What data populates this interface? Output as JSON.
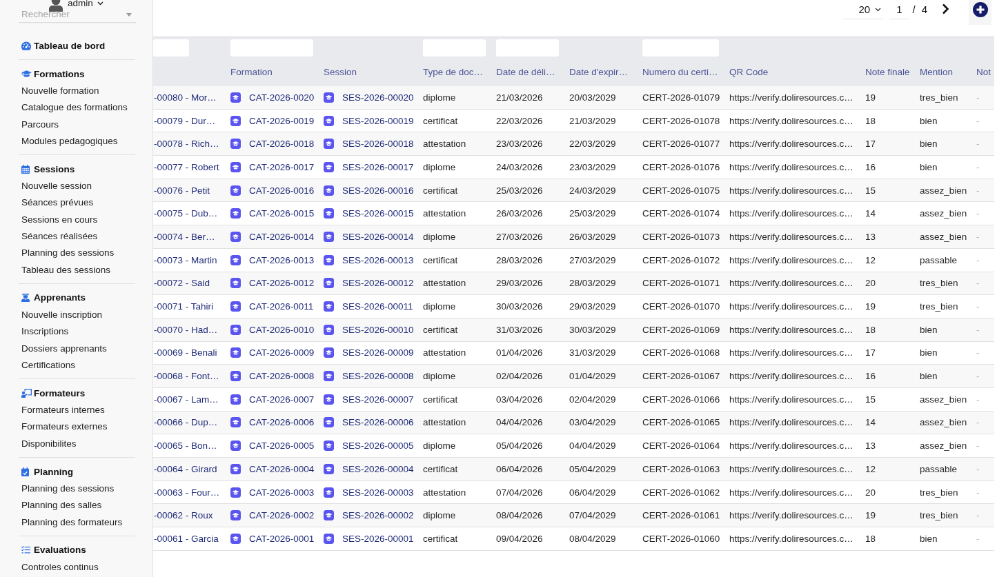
{
  "user_menu": {
    "name": "admin"
  },
  "sidebar": {
    "search": {
      "placeholder": "Rechercher"
    },
    "sections": [
      {
        "title": "Tableau de bord"
      },
      {
        "title": "Formations",
        "items": [
          "Nouvelle formation",
          "Catalogue des formations",
          "Parcours",
          "Modules pedagogiques"
        ]
      },
      {
        "title": "Sessions",
        "items": [
          "Nouvelle session",
          "Séances prévues",
          "Sessions en cours",
          "Séances réalisées",
          "Planning des sessions",
          "Tableau des sessions"
        ]
      },
      {
        "title": "Apprenants",
        "items": [
          "Nouvelle inscription",
          "Inscriptions",
          "Dossiers apprenants",
          "Certifications"
        ]
      },
      {
        "title": "Formateurs",
        "items": [
          "Formateurs internes",
          "Formateurs externes",
          "Disponibilites"
        ]
      },
      {
        "title": "Planning",
        "items": [
          "Planning des sessions",
          "Planning des salles",
          "Planning des formateurs"
        ]
      },
      {
        "title": "Evaluations",
        "items": [
          "Controles continus"
        ]
      }
    ]
  },
  "pagination": {
    "page_size": "20",
    "page": "1",
    "separator": "/",
    "total_pages": "4"
  },
  "table": {
    "columns": [
      {
        "kind": "link",
        "filter": true
      },
      {
        "label": "Formation",
        "kind": "link_icon",
        "filter": true
      },
      {
        "label": "Session",
        "kind": "link_icon",
        "filter": false
      },
      {
        "label": "Type de doc…",
        "kind": "text",
        "filter": true
      },
      {
        "label": "Date de déli…",
        "kind": "text",
        "filter": true
      },
      {
        "label": "Date d'expir…",
        "kind": "text",
        "filter": false
      },
      {
        "label": "Numero du certi…",
        "kind": "text",
        "filter": true
      },
      {
        "label": "QR Code",
        "kind": "text",
        "filter": false
      },
      {
        "label": "Note finale",
        "kind": "text",
        "filter": false
      },
      {
        "label": "Mention",
        "kind": "text",
        "filter": false
      },
      {
        "label": "Not",
        "kind": "muted",
        "filter": false
      }
    ],
    "rows": [
      [
        "-00080 - Mor…",
        "CAT-2026-0020",
        "SES-2026-00020",
        "diplome",
        "21/03/2026",
        "20/03/2029",
        "CERT-2026-01079",
        "https://verify.doliresources.c…",
        "19",
        "tres_bien",
        "-"
      ],
      [
        "-00079 - Dur…",
        "CAT-2026-0019",
        "SES-2026-00019",
        "certificat",
        "22/03/2026",
        "21/03/2029",
        "CERT-2026-01078",
        "https://verify.doliresources.c…",
        "18",
        "bien",
        "-"
      ],
      [
        "-00078 - Rich…",
        "CAT-2026-0018",
        "SES-2026-00018",
        "attestation",
        "23/03/2026",
        "22/03/2029",
        "CERT-2026-01077",
        "https://verify.doliresources.c…",
        "17",
        "bien",
        "-"
      ],
      [
        "-00077 - Robert",
        "CAT-2026-0017",
        "SES-2026-00017",
        "diplome",
        "24/03/2026",
        "23/03/2029",
        "CERT-2026-01076",
        "https://verify.doliresources.c…",
        "16",
        "bien",
        "-"
      ],
      [
        "-00076 - Petit",
        "CAT-2026-0016",
        "SES-2026-00016",
        "certificat",
        "25/03/2026",
        "24/03/2029",
        "CERT-2026-01075",
        "https://verify.doliresources.c…",
        "15",
        "assez_bien",
        "-"
      ],
      [
        "-00075 - Dub…",
        "CAT-2026-0015",
        "SES-2026-00015",
        "attestation",
        "26/03/2026",
        "25/03/2029",
        "CERT-2026-01074",
        "https://verify.doliresources.c…",
        "14",
        "assez_bien",
        "-"
      ],
      [
        "-00074 - Ber…",
        "CAT-2026-0014",
        "SES-2026-00014",
        "diplome",
        "27/03/2026",
        "26/03/2029",
        "CERT-2026-01073",
        "https://verify.doliresources.c…",
        "13",
        "assez_bien",
        "-"
      ],
      [
        "-00073 - Martin",
        "CAT-2026-0013",
        "SES-2026-00013",
        "certificat",
        "28/03/2026",
        "27/03/2029",
        "CERT-2026-01072",
        "https://verify.doliresources.c…",
        "12",
        "passable",
        "-"
      ],
      [
        "-00072 - Said",
        "CAT-2026-0012",
        "SES-2026-00012",
        "attestation",
        "29/03/2026",
        "28/03/2029",
        "CERT-2026-01071",
        "https://verify.doliresources.c…",
        "20",
        "tres_bien",
        "-"
      ],
      [
        "-00071 - Tahiri",
        "CAT-2026-0011",
        "SES-2026-00011",
        "diplome",
        "30/03/2026",
        "29/03/2029",
        "CERT-2026-01070",
        "https://verify.doliresources.c…",
        "19",
        "tres_bien",
        "-"
      ],
      [
        "-00070 - Had…",
        "CAT-2026-0010",
        "SES-2026-00010",
        "certificat",
        "31/03/2026",
        "30/03/2029",
        "CERT-2026-01069",
        "https://verify.doliresources.c…",
        "18",
        "bien",
        "-"
      ],
      [
        "-00069 - Benali",
        "CAT-2026-0009",
        "SES-2026-00009",
        "attestation",
        "01/04/2026",
        "31/03/2029",
        "CERT-2026-01068",
        "https://verify.doliresources.c…",
        "17",
        "bien",
        "-"
      ],
      [
        "-00068 - Font…",
        "CAT-2026-0008",
        "SES-2026-00008",
        "diplome",
        "02/04/2026",
        "01/04/2029",
        "CERT-2026-01067",
        "https://verify.doliresources.c…",
        "16",
        "bien",
        "-"
      ],
      [
        "-00067 - Lam…",
        "CAT-2026-0007",
        "SES-2026-00007",
        "certificat",
        "03/04/2026",
        "02/04/2029",
        "CERT-2026-01066",
        "https://verify.doliresources.c…",
        "15",
        "assez_bien",
        "-"
      ],
      [
        "-00066 - Dup…",
        "CAT-2026-0006",
        "SES-2026-00006",
        "attestation",
        "04/04/2026",
        "03/04/2029",
        "CERT-2026-01065",
        "https://verify.doliresources.c…",
        "14",
        "assez_bien",
        "-"
      ],
      [
        "-00065 - Bon…",
        "CAT-2026-0005",
        "SES-2026-00005",
        "diplome",
        "05/04/2026",
        "04/04/2029",
        "CERT-2026-01064",
        "https://verify.doliresources.c…",
        "13",
        "assez_bien",
        "-"
      ],
      [
        "-00064 - Girard",
        "CAT-2026-0004",
        "SES-2026-00004",
        "certificat",
        "06/04/2026",
        "05/04/2029",
        "CERT-2026-01063",
        "https://verify.doliresources.c…",
        "12",
        "passable",
        "-"
      ],
      [
        "-00063 - Four…",
        "CAT-2026-0003",
        "SES-2026-00003",
        "attestation",
        "07/04/2026",
        "06/04/2029",
        "CERT-2026-01062",
        "https://verify.doliresources.c…",
        "20",
        "tres_bien",
        "-"
      ],
      [
        "-00062 - Roux",
        "CAT-2026-0002",
        "SES-2026-00002",
        "diplome",
        "08/04/2026",
        "07/04/2029",
        "CERT-2026-01061",
        "https://verify.doliresources.c…",
        "19",
        "tres_bien",
        "-"
      ],
      [
        "-00061 - Garcia",
        "CAT-2026-0001",
        "SES-2026-00001",
        "certificat",
        "09/04/2026",
        "08/04/2029",
        "CERT-2026-01060",
        "https://verify.doliresources.c…",
        "18",
        "bien",
        "-"
      ]
    ]
  }
}
